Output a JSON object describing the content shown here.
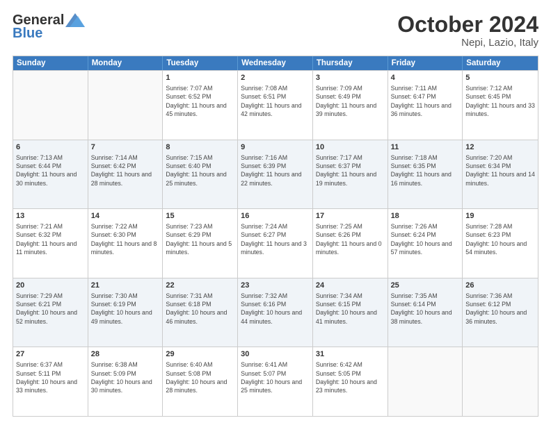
{
  "header": {
    "logo_general": "General",
    "logo_blue": "Blue",
    "month": "October 2024",
    "location": "Nepi, Lazio, Italy"
  },
  "days_of_week": [
    "Sunday",
    "Monday",
    "Tuesday",
    "Wednesday",
    "Thursday",
    "Friday",
    "Saturday"
  ],
  "weeks": [
    [
      {
        "day": "",
        "info": "",
        "empty": true
      },
      {
        "day": "",
        "info": "",
        "empty": true
      },
      {
        "day": "1",
        "info": "Sunrise: 7:07 AM\nSunset: 6:52 PM\nDaylight: 11 hours and 45 minutes."
      },
      {
        "day": "2",
        "info": "Sunrise: 7:08 AM\nSunset: 6:51 PM\nDaylight: 11 hours and 42 minutes."
      },
      {
        "day": "3",
        "info": "Sunrise: 7:09 AM\nSunset: 6:49 PM\nDaylight: 11 hours and 39 minutes."
      },
      {
        "day": "4",
        "info": "Sunrise: 7:11 AM\nSunset: 6:47 PM\nDaylight: 11 hours and 36 minutes."
      },
      {
        "day": "5",
        "info": "Sunrise: 7:12 AM\nSunset: 6:45 PM\nDaylight: 11 hours and 33 minutes."
      }
    ],
    [
      {
        "day": "6",
        "info": "Sunrise: 7:13 AM\nSunset: 6:44 PM\nDaylight: 11 hours and 30 minutes."
      },
      {
        "day": "7",
        "info": "Sunrise: 7:14 AM\nSunset: 6:42 PM\nDaylight: 11 hours and 28 minutes."
      },
      {
        "day": "8",
        "info": "Sunrise: 7:15 AM\nSunset: 6:40 PM\nDaylight: 11 hours and 25 minutes."
      },
      {
        "day": "9",
        "info": "Sunrise: 7:16 AM\nSunset: 6:39 PM\nDaylight: 11 hours and 22 minutes."
      },
      {
        "day": "10",
        "info": "Sunrise: 7:17 AM\nSunset: 6:37 PM\nDaylight: 11 hours and 19 minutes."
      },
      {
        "day": "11",
        "info": "Sunrise: 7:18 AM\nSunset: 6:35 PM\nDaylight: 11 hours and 16 minutes."
      },
      {
        "day": "12",
        "info": "Sunrise: 7:20 AM\nSunset: 6:34 PM\nDaylight: 11 hours and 14 minutes."
      }
    ],
    [
      {
        "day": "13",
        "info": "Sunrise: 7:21 AM\nSunset: 6:32 PM\nDaylight: 11 hours and 11 minutes."
      },
      {
        "day": "14",
        "info": "Sunrise: 7:22 AM\nSunset: 6:30 PM\nDaylight: 11 hours and 8 minutes."
      },
      {
        "day": "15",
        "info": "Sunrise: 7:23 AM\nSunset: 6:29 PM\nDaylight: 11 hours and 5 minutes."
      },
      {
        "day": "16",
        "info": "Sunrise: 7:24 AM\nSunset: 6:27 PM\nDaylight: 11 hours and 3 minutes."
      },
      {
        "day": "17",
        "info": "Sunrise: 7:25 AM\nSunset: 6:26 PM\nDaylight: 11 hours and 0 minutes."
      },
      {
        "day": "18",
        "info": "Sunrise: 7:26 AM\nSunset: 6:24 PM\nDaylight: 10 hours and 57 minutes."
      },
      {
        "day": "19",
        "info": "Sunrise: 7:28 AM\nSunset: 6:23 PM\nDaylight: 10 hours and 54 minutes."
      }
    ],
    [
      {
        "day": "20",
        "info": "Sunrise: 7:29 AM\nSunset: 6:21 PM\nDaylight: 10 hours and 52 minutes."
      },
      {
        "day": "21",
        "info": "Sunrise: 7:30 AM\nSunset: 6:19 PM\nDaylight: 10 hours and 49 minutes."
      },
      {
        "day": "22",
        "info": "Sunrise: 7:31 AM\nSunset: 6:18 PM\nDaylight: 10 hours and 46 minutes."
      },
      {
        "day": "23",
        "info": "Sunrise: 7:32 AM\nSunset: 6:16 PM\nDaylight: 10 hours and 44 minutes."
      },
      {
        "day": "24",
        "info": "Sunrise: 7:34 AM\nSunset: 6:15 PM\nDaylight: 10 hours and 41 minutes."
      },
      {
        "day": "25",
        "info": "Sunrise: 7:35 AM\nSunset: 6:14 PM\nDaylight: 10 hours and 38 minutes."
      },
      {
        "day": "26",
        "info": "Sunrise: 7:36 AM\nSunset: 6:12 PM\nDaylight: 10 hours and 36 minutes."
      }
    ],
    [
      {
        "day": "27",
        "info": "Sunrise: 6:37 AM\nSunset: 5:11 PM\nDaylight: 10 hours and 33 minutes."
      },
      {
        "day": "28",
        "info": "Sunrise: 6:38 AM\nSunset: 5:09 PM\nDaylight: 10 hours and 30 minutes."
      },
      {
        "day": "29",
        "info": "Sunrise: 6:40 AM\nSunset: 5:08 PM\nDaylight: 10 hours and 28 minutes."
      },
      {
        "day": "30",
        "info": "Sunrise: 6:41 AM\nSunset: 5:07 PM\nDaylight: 10 hours and 25 minutes."
      },
      {
        "day": "31",
        "info": "Sunrise: 6:42 AM\nSunset: 5:05 PM\nDaylight: 10 hours and 23 minutes."
      },
      {
        "day": "",
        "info": "",
        "empty": true
      },
      {
        "day": "",
        "info": "",
        "empty": true
      }
    ]
  ]
}
